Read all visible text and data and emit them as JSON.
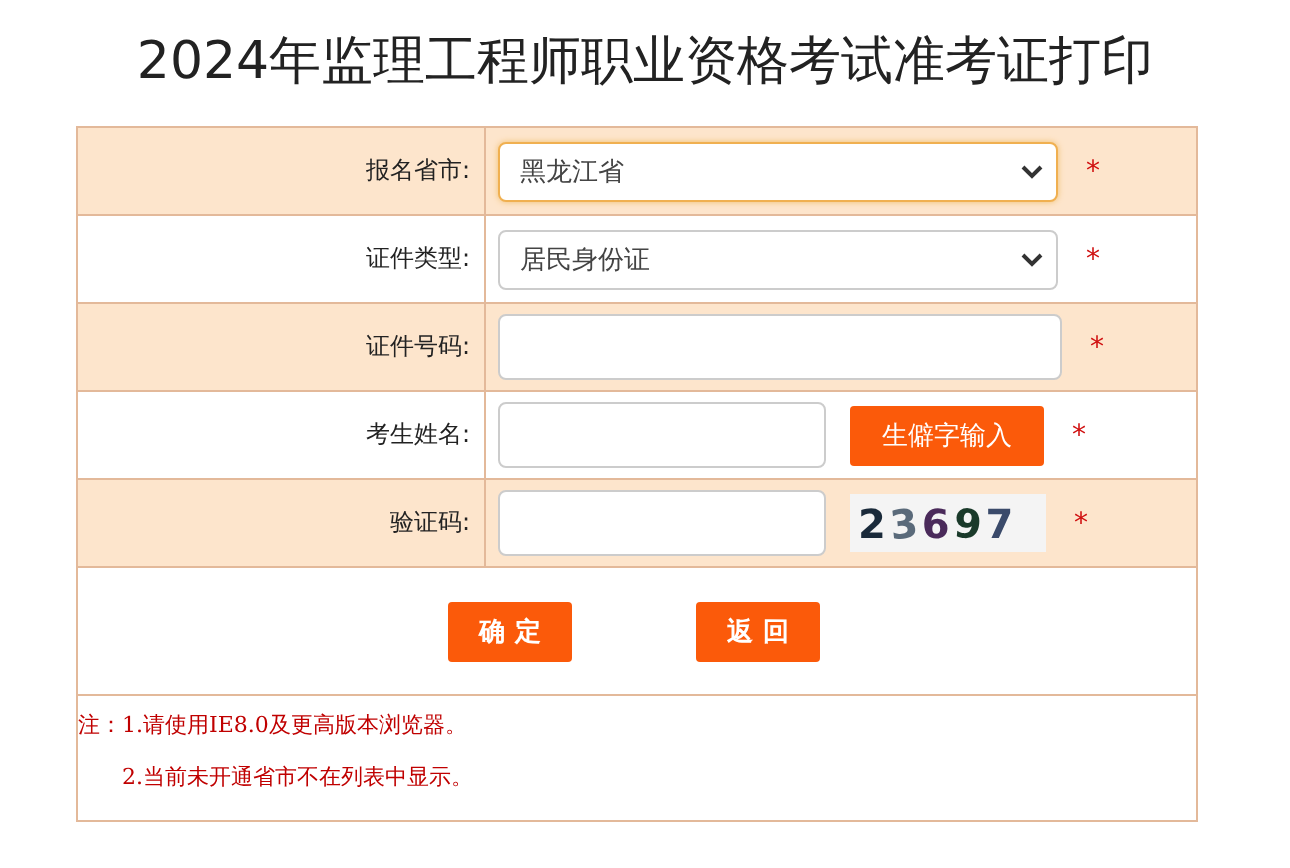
{
  "title": "2024年监理工程师职业资格考试准考证打印",
  "rows": [
    {
      "label": "报名省市:",
      "kind": "select",
      "value": "黑龙江省",
      "focused": true,
      "required": "*"
    },
    {
      "label": "证件类型:",
      "kind": "select",
      "value": "居民身份证",
      "focused": false,
      "required": "*"
    },
    {
      "label": "证件号码:",
      "kind": "input",
      "focused": false,
      "required": "*"
    },
    {
      "label": "考生姓名:",
      "kind": "input_button",
      "button": "生僻字输入",
      "focused": false,
      "required": "*"
    },
    {
      "label": "验证码:",
      "kind": "captcha",
      "captcha": "23697",
      "focused": false,
      "required": "*"
    }
  ],
  "buttons": [
    "确 定",
    "返 回"
  ],
  "notes": [
    "注：1.请使用IE8.0及更高版本浏览器。",
    "2.当前未开通省市不在列表中显示。"
  ]
}
